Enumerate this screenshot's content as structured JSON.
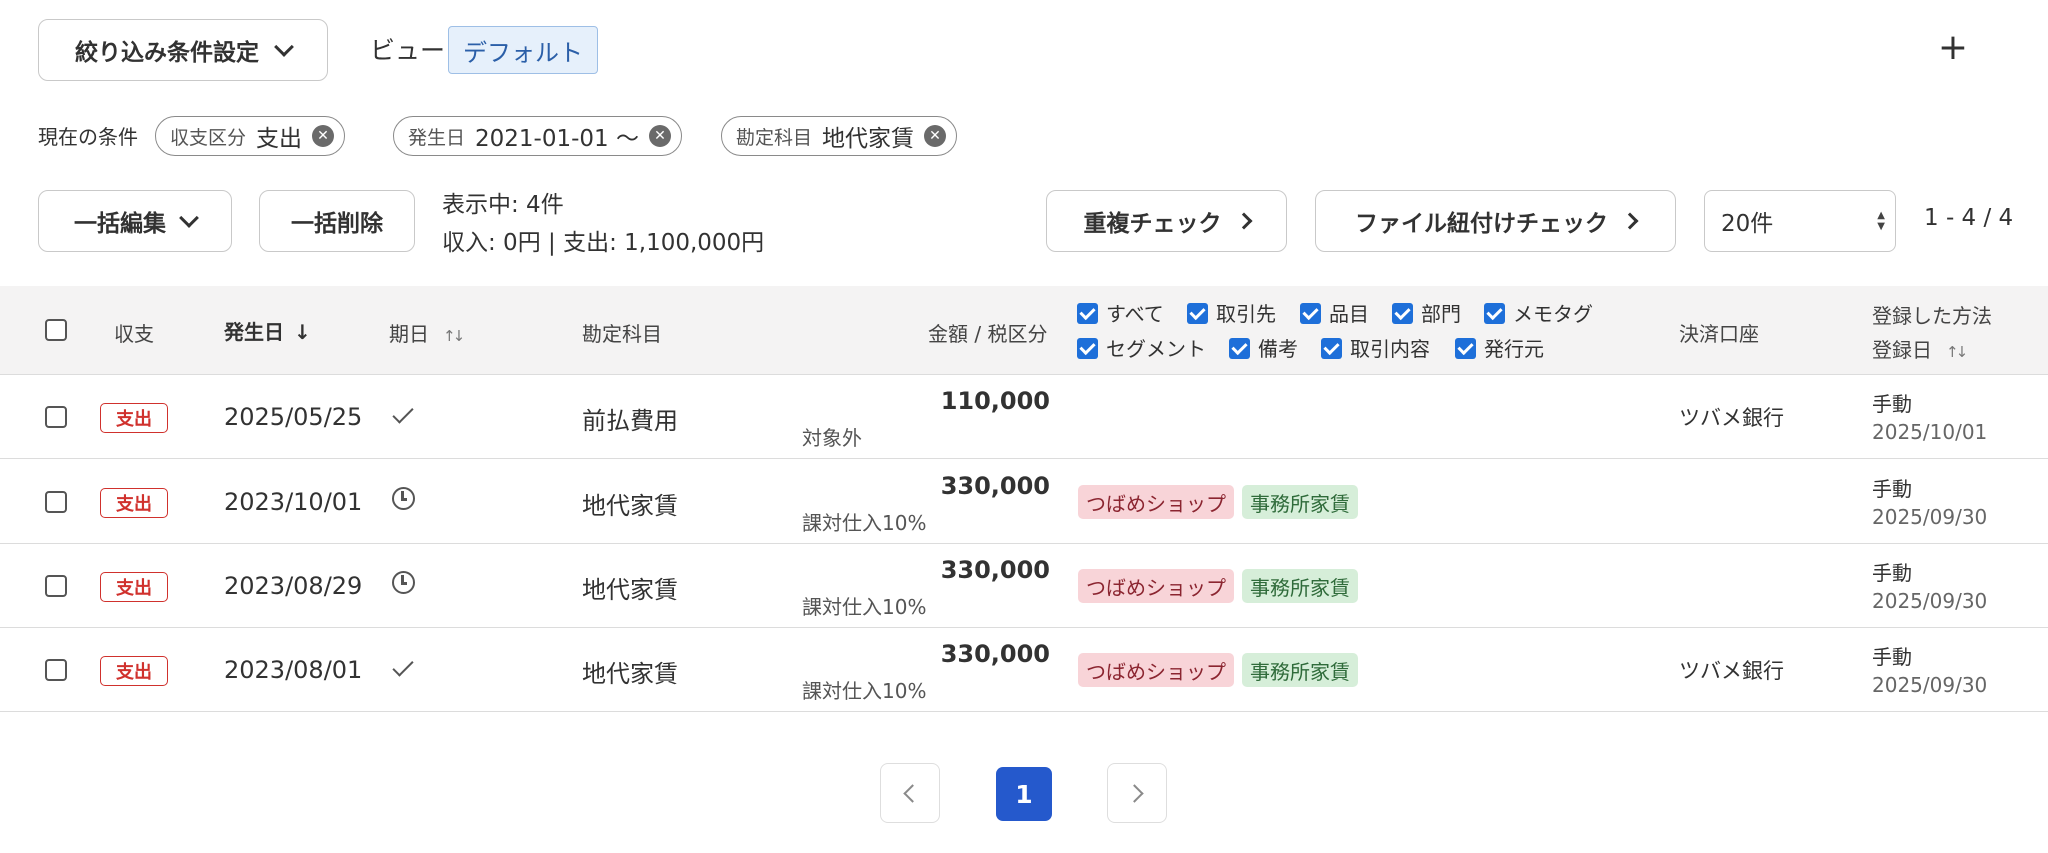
{
  "filter": {
    "settings_label": "絞り込み条件設定",
    "view_label": "ビュー",
    "view_value": "デフォルト",
    "add": "+"
  },
  "conditions": {
    "label": "現在の条件",
    "chips": [
      {
        "key": "収支区分",
        "value": "支出"
      },
      {
        "key": "発生日",
        "value": "2021-01-01 〜"
      },
      {
        "key": "勘定科目",
        "value": "地代家賃"
      }
    ]
  },
  "actions": {
    "bulk_edit": "一括編集",
    "bulk_delete": "一括削除",
    "showing": "表示中: 4件",
    "totals": "収入: 0円 | 支出: 1,100,000円",
    "dup_check": "重複チェック",
    "file_check": "ファイル紐付けチェック",
    "per_page": "20件",
    "range": "1 - 4 / 4"
  },
  "table": {
    "headers": {
      "type": "収支",
      "date": "発生日",
      "due": "期日",
      "account": "勘定科目",
      "amount": "金額 / 税区分",
      "bank": "決済口座",
      "method": "登録した方法",
      "reg_date": "登録日"
    },
    "column_options": [
      "すべて",
      "取引先",
      "品目",
      "部門",
      "メモタグ",
      "セグメント",
      "備考",
      "取引内容",
      "発行元"
    ],
    "rows": [
      {
        "type": "支出",
        "date": "2025/05/25",
        "due": "done",
        "account": "前払費用",
        "amount": "110,000",
        "tax": "対象外",
        "partner": "",
        "item": "",
        "bank": "ツバメ銀行",
        "method": "手動",
        "reg_date": "2025/10/01"
      },
      {
        "type": "支出",
        "date": "2023/10/01",
        "due": "pending",
        "account": "地代家賃",
        "amount": "330,000",
        "tax": "課対仕入10%",
        "partner": "つばめショップ",
        "item": "事務所家賃",
        "bank": "",
        "method": "手動",
        "reg_date": "2025/09/30"
      },
      {
        "type": "支出",
        "date": "2023/08/29",
        "due": "pending",
        "account": "地代家賃",
        "amount": "330,000",
        "tax": "課対仕入10%",
        "partner": "つばめショップ",
        "item": "事務所家賃",
        "bank": "",
        "method": "手動",
        "reg_date": "2025/09/30"
      },
      {
        "type": "支出",
        "date": "2023/08/01",
        "due": "done",
        "account": "地代家賃",
        "amount": "330,000",
        "tax": "課対仕入10%",
        "partner": "つばめショップ",
        "item": "事務所家賃",
        "bank": "ツバメ銀行",
        "method": "手動",
        "reg_date": "2025/09/30"
      }
    ]
  },
  "pagination": {
    "current": "1"
  },
  "colors": {
    "accent": "#2559cc",
    "expense": "#d0312d",
    "partner_tag": "#f8d4d8",
    "item_tag": "#d6eed9",
    "header_bg": "#f4f3f3"
  }
}
